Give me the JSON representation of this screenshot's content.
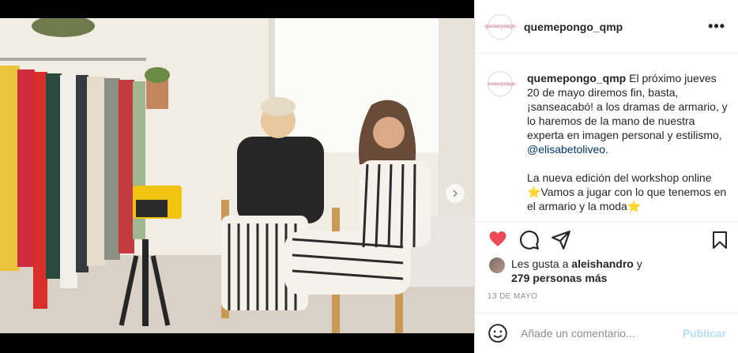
{
  "post": {
    "username": "quemepongo_qmp",
    "avatar_text": "quemepongo",
    "more_icon": "•••"
  },
  "caption": {
    "username": "quemepongo_qmp",
    "text_1": " El próximo jueves 20 de mayo diremos fin, basta, ¡sanseacabó! a los dramas de armario, y lo haremos de la mano de nuestra experta en imagen personal y estilismo, ",
    "mention": "@elisabetoliveo",
    "text_2": ".",
    "text_3": "La nueva edición del workshop online ⭐Vamos a jugar con lo que tenemos en el armario y la moda⭐"
  },
  "likes": {
    "prefix": "Les gusta a ",
    "user": "aleishandro",
    "connector": " y",
    "others": "279 personas más"
  },
  "date": "13 DE MAYO",
  "comment": {
    "placeholder": "Añade un comentario...",
    "publish_label": "Publicar"
  },
  "colors": {
    "like_red": "#ed4956",
    "link_blue": "#00376b",
    "publish_disabled": "#b2dffc"
  },
  "icons": [
    "heart-icon",
    "comment-icon",
    "share-icon",
    "bookmark-icon",
    "emoji-icon",
    "more-icon",
    "chevron-right-icon"
  ]
}
